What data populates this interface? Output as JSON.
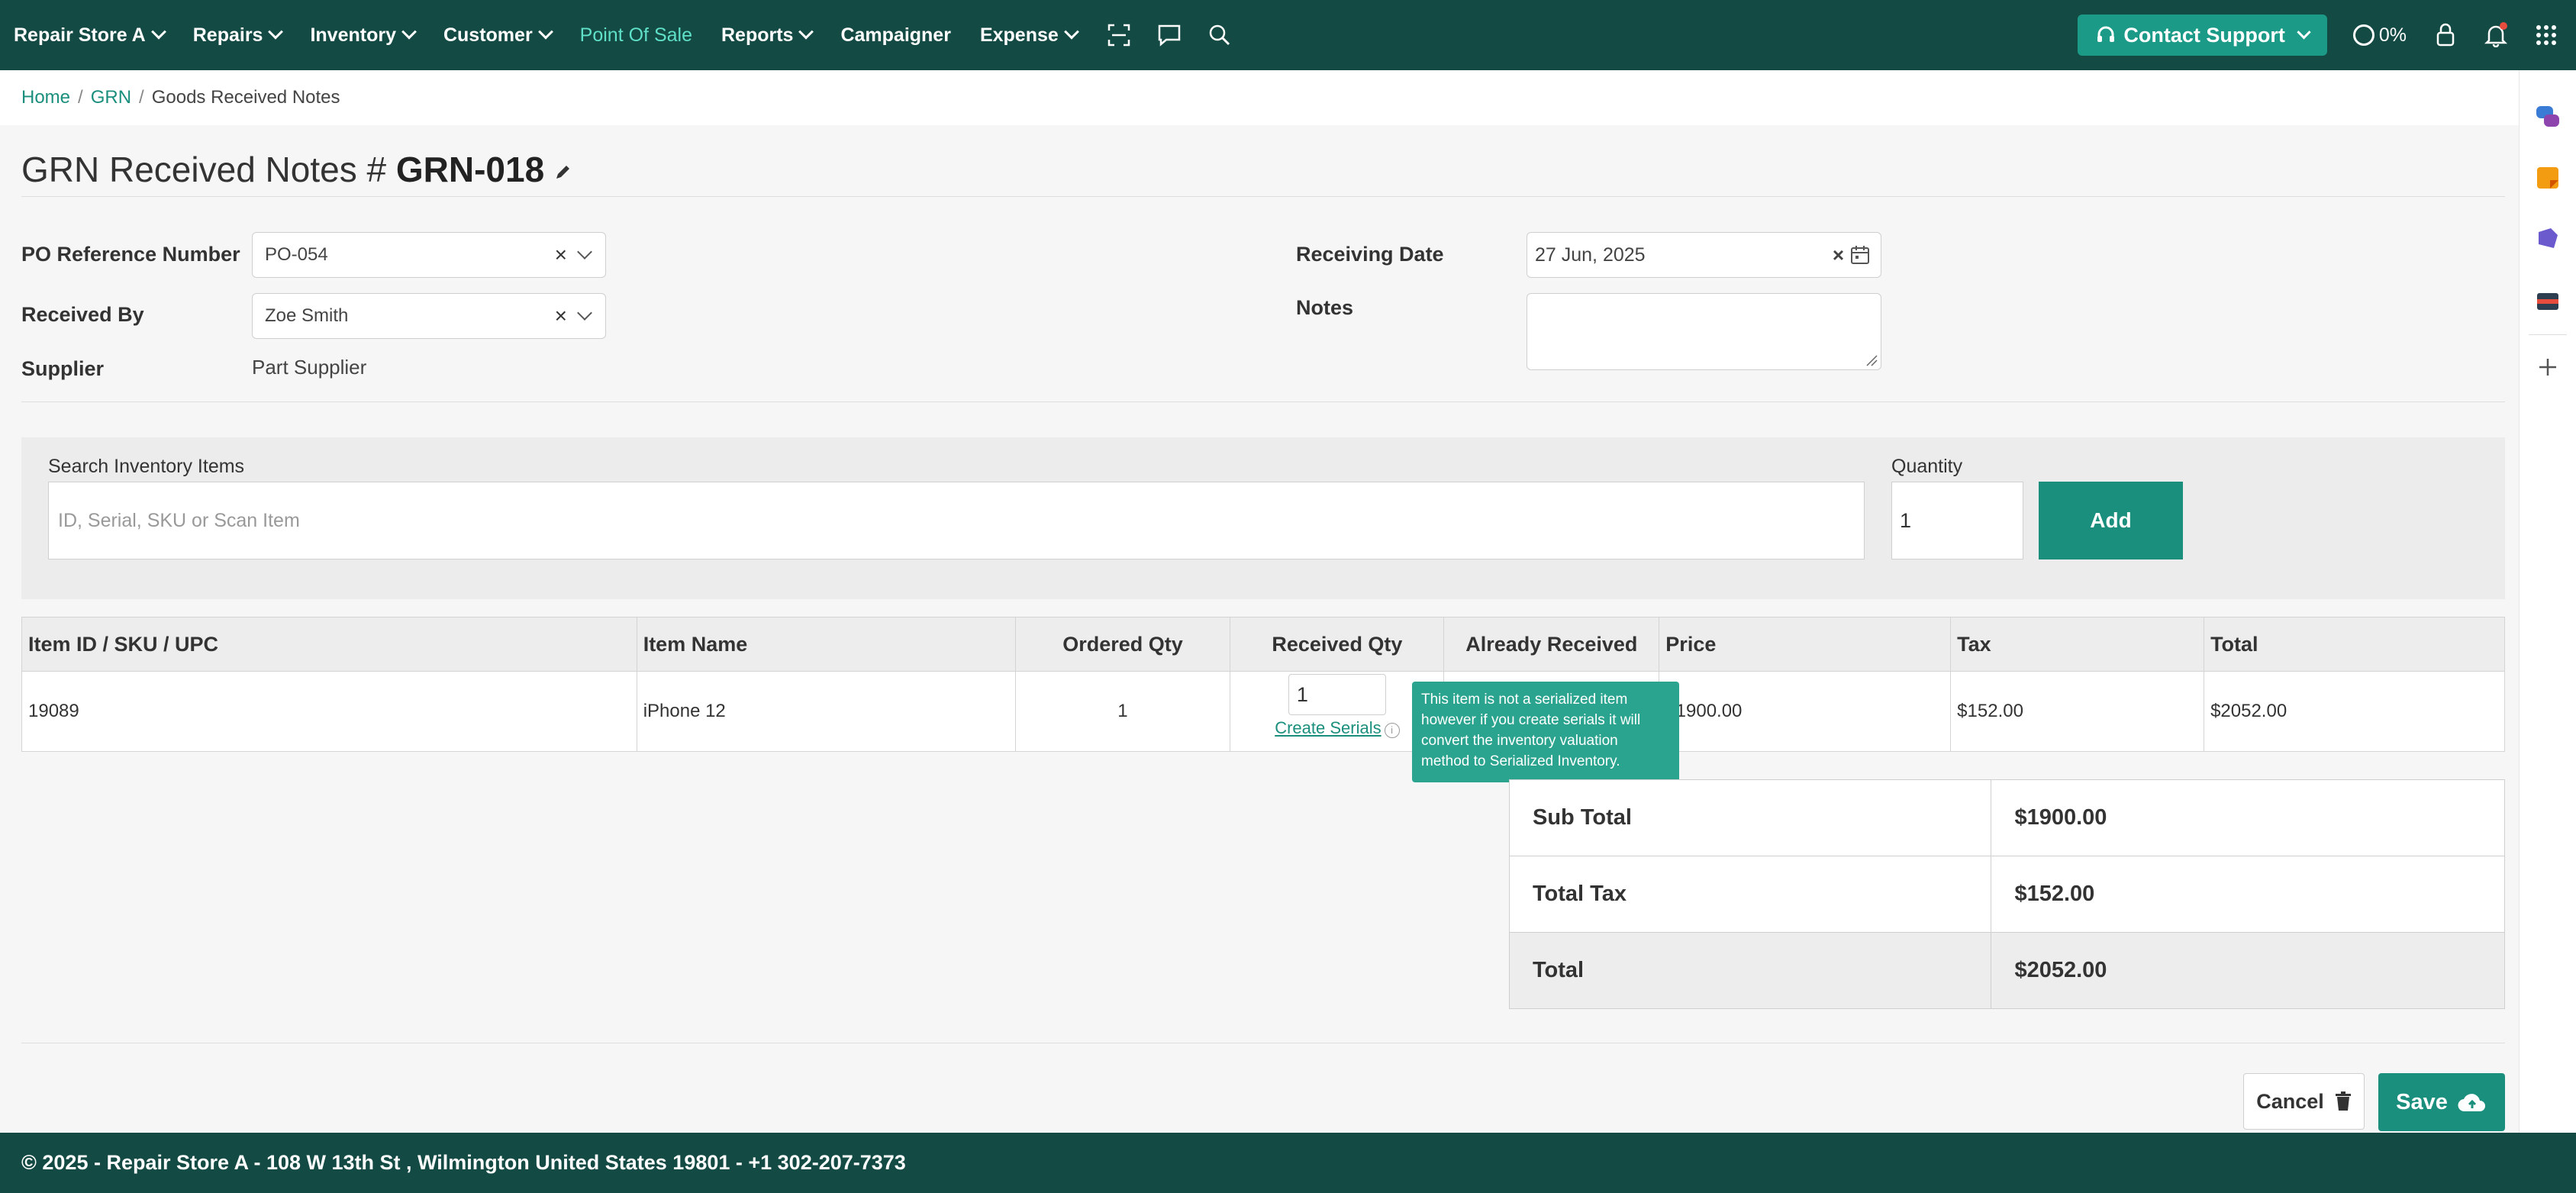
{
  "nav": {
    "items": [
      {
        "label": "Repair Store A",
        "dropdown": true
      },
      {
        "label": "Repairs",
        "dropdown": true
      },
      {
        "label": "Inventory",
        "dropdown": true
      },
      {
        "label": "Customer",
        "dropdown": true
      },
      {
        "label": "Point Of Sale",
        "dropdown": false,
        "active": true
      },
      {
        "label": "Reports",
        "dropdown": true
      },
      {
        "label": "Campaigner",
        "dropdown": false
      },
      {
        "label": "Expense",
        "dropdown": true
      }
    ],
    "icons": [
      "scan-icon",
      "chat-icon",
      "search-icon"
    ],
    "contact_label": "Contact Support",
    "progress_label": "0%",
    "right_icons": [
      "lock-icon",
      "bell-icon",
      "apps-grid-icon"
    ],
    "bg_color": "#144a44",
    "accent": "#1a8f7d"
  },
  "breadcrumb": {
    "home": "Home",
    "grn": "GRN",
    "current": "Goods Received Notes",
    "sep": "/"
  },
  "title": {
    "prefix": "GRN Received Notes # ",
    "code": "GRN-018"
  },
  "form": {
    "po_label": "PO Reference Number",
    "po_value": "PO-054",
    "received_by_label": "Received By",
    "received_by_value": "Zoe Smith",
    "supplier_label": "Supplier",
    "supplier_value": "Part Supplier",
    "receiving_date_label": "Receiving Date",
    "receiving_date_value": "27 Jun, 2025",
    "notes_label": "Notes",
    "notes_value": "",
    "clear_glyph": "×"
  },
  "search": {
    "label": "Search Inventory Items",
    "placeholder": "ID, Serial, SKU or Scan Item",
    "qty_label": "Quantity",
    "qty_value": "1",
    "add_label": "Add"
  },
  "table": {
    "headers": [
      "Item ID / SKU / UPC",
      "Item Name",
      "Ordered Qty",
      "Received Qty",
      "Already Received",
      "Price",
      "Tax",
      "Total"
    ],
    "rows": [
      {
        "id": "19089",
        "name": "iPhone 12",
        "ordered": "1",
        "received": "1",
        "already": "",
        "price": "$1900.00",
        "tax": "$152.00",
        "total": "$2052.00"
      }
    ],
    "create_serials": "Create Serials",
    "info_glyph": "i"
  },
  "tooltip": {
    "text": "This item is not a serialized item however if you create serials it will convert the inventory valuation method to Serialized Inventory."
  },
  "totals": {
    "subtotal_label": "Sub Total",
    "subtotal_value": "$1900.00",
    "tax_label": "Total Tax",
    "tax_value": "$152.00",
    "total_label": "Total",
    "total_value": "$2052.00"
  },
  "actions": {
    "cancel": "Cancel",
    "save": "Save"
  },
  "footer": {
    "text": "© 2025 - Repair Store A - 108 W 13th St , Wilmington United States 19801 - +1 302-207-7373"
  }
}
